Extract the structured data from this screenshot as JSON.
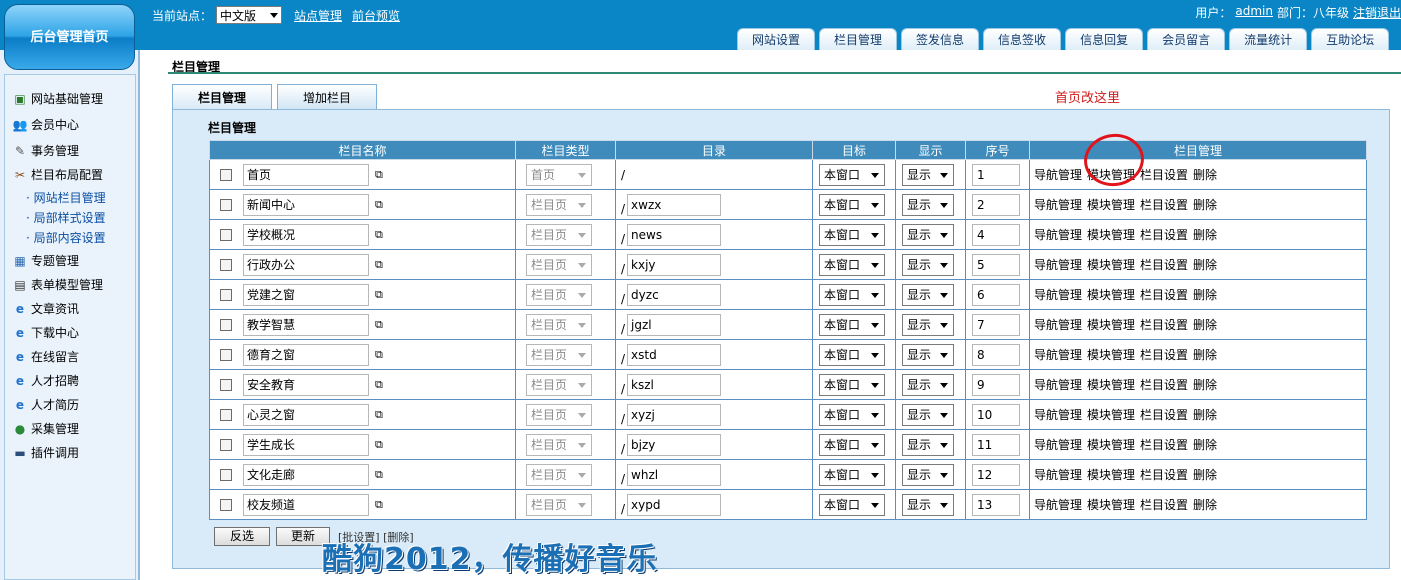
{
  "header": {
    "home_button": "后台管理首页",
    "site_label": "当前站点：",
    "site_select": "中文版",
    "links": [
      "站点管理",
      "前台预览"
    ],
    "user_label": "用户：",
    "user_name": "admin",
    "dept": "部门：八年级",
    "logout": "注销退出",
    "tabs": [
      "网站设置",
      "栏目管理",
      "签发信息",
      "信息签收",
      "信息回复",
      "会员留言",
      "流量统计",
      "互助论坛"
    ]
  },
  "sidebar": {
    "items": [
      {
        "label": "网站基础管理",
        "icon": "site-icon"
      },
      {
        "label": "会员中心",
        "icon": "members-icon"
      },
      {
        "label": "事务管理",
        "icon": "affairs-icon"
      },
      {
        "label": "栏目布局配置",
        "icon": "tools-icon"
      },
      {
        "label": "专题管理",
        "icon": "topic-icon"
      },
      {
        "label": "表单模型管理",
        "icon": "form-icon"
      },
      {
        "label": "文章资讯",
        "icon": "ie-icon"
      },
      {
        "label": "下载中心",
        "icon": "ie-icon"
      },
      {
        "label": "在线留言",
        "icon": "ie-icon"
      },
      {
        "label": "人才招聘",
        "icon": "ie-icon"
      },
      {
        "label": "人才简历",
        "icon": "ie-icon"
      },
      {
        "label": "采集管理",
        "icon": "globe-icon"
      },
      {
        "label": "插件调用",
        "icon": "plugin-icon"
      }
    ],
    "subitems": [
      "· 网站栏目管理",
      "· 局部样式设置",
      "· 局部内容设置"
    ]
  },
  "main": {
    "title": "栏目管理",
    "tabs": [
      "栏目管理",
      "增加栏目"
    ],
    "note": "首页改这里",
    "panel_title": "栏目管理",
    "columns": [
      "栏目名称",
      "栏目类型",
      "目录",
      "目标",
      "显示",
      "序号",
      "栏目管理"
    ],
    "rows": [
      {
        "name": "首页",
        "type": "首页",
        "dir": "",
        "target": "本窗口",
        "show": "显示",
        "order": "1"
      },
      {
        "name": "新闻中心",
        "type": "栏目页",
        "dir": "xwzx",
        "target": "本窗口",
        "show": "显示",
        "order": "2"
      },
      {
        "name": "学校概况",
        "type": "栏目页",
        "dir": "news",
        "target": "本窗口",
        "show": "显示",
        "order": "4"
      },
      {
        "name": "行政办公",
        "type": "栏目页",
        "dir": "kxjy",
        "target": "本窗口",
        "show": "显示",
        "order": "5"
      },
      {
        "name": "党建之窗",
        "type": "栏目页",
        "dir": "dyzc",
        "target": "本窗口",
        "show": "显示",
        "order": "6"
      },
      {
        "name": "教学智慧",
        "type": "栏目页",
        "dir": "jgzl",
        "target": "本窗口",
        "show": "显示",
        "order": "7"
      },
      {
        "name": "德育之窗",
        "type": "栏目页",
        "dir": "xstd",
        "target": "本窗口",
        "show": "显示",
        "order": "8"
      },
      {
        "name": "安全教育",
        "type": "栏目页",
        "dir": "kszl",
        "target": "本窗口",
        "show": "显示",
        "order": "9"
      },
      {
        "name": "心灵之窗",
        "type": "栏目页",
        "dir": "xyzj",
        "target": "本窗口",
        "show": "显示",
        "order": "10"
      },
      {
        "name": "学生成长",
        "type": "栏目页",
        "dir": "bjzy",
        "target": "本窗口",
        "show": "显示",
        "order": "11"
      },
      {
        "name": "文化走廊",
        "type": "栏目页",
        "dir": "whzl",
        "target": "本窗口",
        "show": "显示",
        "order": "12"
      },
      {
        "name": "校友频道",
        "type": "栏目页",
        "dir": "xypd",
        "target": "本窗口",
        "show": "显示",
        "order": "13"
      }
    ],
    "actions": [
      "导航管理",
      "模块管理",
      "栏目设置",
      "删除"
    ],
    "buttons": {
      "invert": "反选",
      "update": "更新"
    },
    "bottom_links": "[批设置]  [删除]",
    "watermark": "酷狗2012，传播好音乐"
  }
}
